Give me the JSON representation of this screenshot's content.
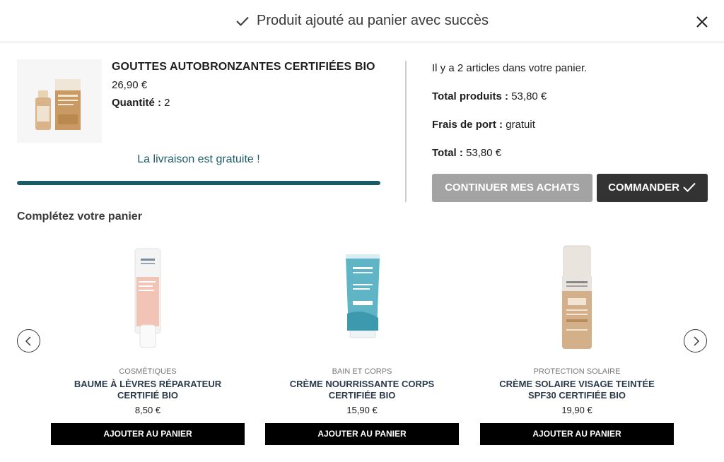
{
  "modal": {
    "title": "Produit ajouté au panier avec succès",
    "close_icon": "close-icon",
    "check_icon": "check-icon"
  },
  "added_product": {
    "name": "GOUTTES AUTOBRONZANTES CERTIFIÉES BIO",
    "price": "26,90 €",
    "quantity_label": "Quantité :",
    "quantity_value": "2",
    "image_icon": "self-tanning-drops-product-image"
  },
  "shipping": {
    "message": "La livraison est gratuite !",
    "progress_fraction": 1.0,
    "progress_color": "#1a5c66"
  },
  "cart_summary": {
    "items_text": "Il y a 2 articles dans votre panier.",
    "total_products_label": "Total produits :",
    "total_products_value": "53,80 €",
    "shipping_label": "Frais de port :",
    "shipping_value": "gratuit",
    "total_label": "Total :",
    "total_value": "53,80 €"
  },
  "actions": {
    "continue_label": "CONTINUER MES ACHATS",
    "order_label": "COMMANDER",
    "continue_color": "#a3a3a3",
    "order_color": "#333333"
  },
  "upsell": {
    "title": "Complétez votre panier",
    "prev_icon": "chevron-left-icon",
    "next_icon": "chevron-right-icon",
    "products": [
      {
        "category": "COSMÉTIQUES",
        "name": "BAUME À LÈVRES RÉPARATEUR CERTIFIÉ BIO",
        "price": "8,50 €",
        "button": "AJOUTER AU PANIER",
        "image_icon": "lip-balm-tube-image"
      },
      {
        "category": "BAIN ET CORPS",
        "name": "CRÈME NOURRISSANTE CORPS CERTIFIÉE BIO",
        "price": "15,90 €",
        "button": "AJOUTER AU PANIER",
        "image_icon": "body-cream-tube-image"
      },
      {
        "category": "PROTECTION SOLAIRE",
        "name": "CRÈME SOLAIRE VISAGE TEINTÉE SPF30 CERTIFIÉE BIO",
        "price": "19,90 €",
        "button": "AJOUTER AU PANIER",
        "image_icon": "tinted-sunscreen-bottle-image"
      }
    ]
  }
}
